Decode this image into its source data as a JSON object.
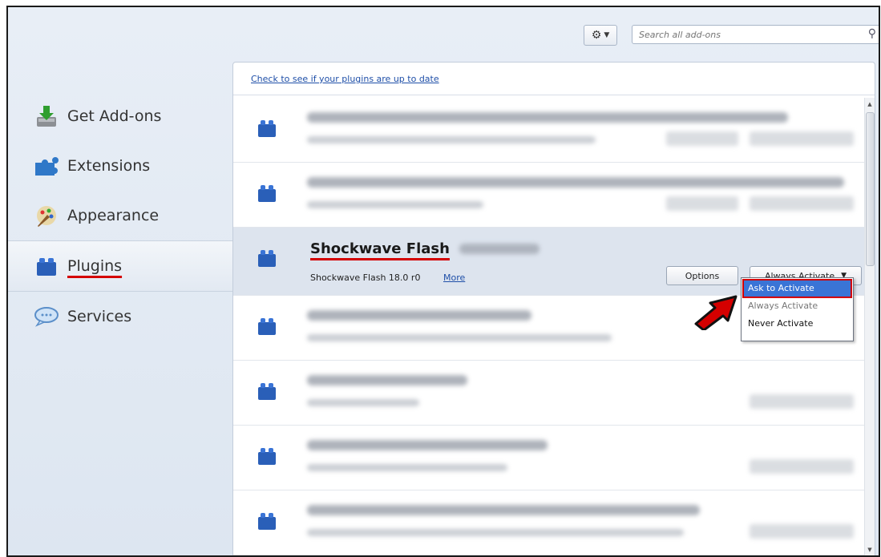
{
  "toolbar": {
    "search_placeholder": "Search all add-ons",
    "tools_icon": "gear-icon"
  },
  "sidebar": {
    "items": [
      {
        "label": "Get Add-ons",
        "icon": "get-addons-icon"
      },
      {
        "label": "Extensions",
        "icon": "puzzle-icon"
      },
      {
        "label": "Appearance",
        "icon": "brush-icon"
      },
      {
        "label": "Plugins",
        "icon": "lego-icon",
        "selected": true
      },
      {
        "label": "Services",
        "icon": "chat-bubble-icon"
      }
    ]
  },
  "main": {
    "update_link": "Check to see if your plugins are up to date",
    "selected_plugin": {
      "name": "Shockwave Flash",
      "description": "Shockwave Flash 18.0 r0",
      "more_label": "More",
      "options_label": "Options",
      "activation_value": "Always Activate"
    }
  },
  "dropdown": {
    "options": [
      "Ask to Activate",
      "Always Activate",
      "Never Activate"
    ],
    "highlighted": "Ask to Activate"
  },
  "colors": {
    "accent_underline": "#d40000",
    "highlight_blue": "#3a74d6",
    "link_blue": "#1f4fa8"
  }
}
